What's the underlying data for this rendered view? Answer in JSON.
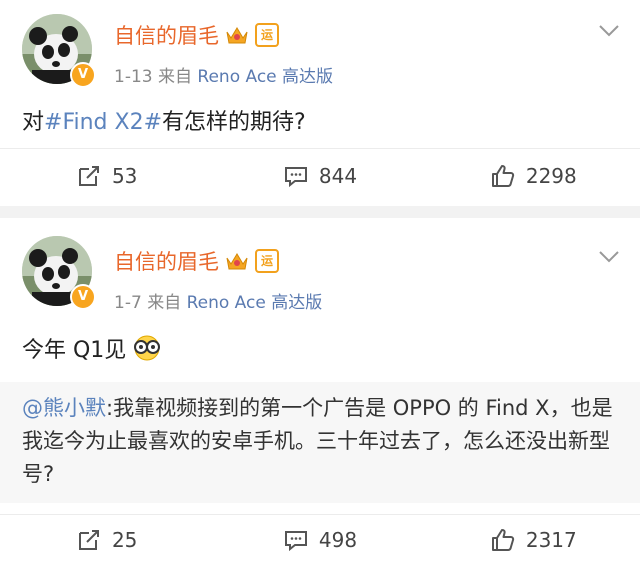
{
  "posts": [
    {
      "username": "自信的眉毛",
      "badge_text": "运",
      "date": "1-13",
      "source_prefix": "来自",
      "device": "Reno Ace 高达版",
      "content_prefix": "对",
      "hashtag": "#Find X2#",
      "content_suffix": "有怎样的期待?",
      "reposts": "53",
      "comments": "844",
      "likes": "2298"
    },
    {
      "username": "自信的眉毛",
      "badge_text": "运",
      "date": "1-7",
      "source_prefix": "来自",
      "device": "Reno Ace 高达版",
      "content": "今年 Q1见",
      "quote_mention": "@熊小默",
      "quote_text": ":我靠视频接到的第一个广告是 OPPO 的 Find X，也是我迄今为止最喜欢的安卓手机。三十年过去了，怎么还没出新型号?",
      "reposts": "25",
      "comments": "498",
      "likes": "2317"
    }
  ],
  "colors": {
    "username": "#e8672b",
    "link": "#5b83bd",
    "meta": "#888888",
    "verified": "#f8a51f"
  },
  "icons": [
    "panda-avatar",
    "verified-icon",
    "crown-icon",
    "chevron-down-icon",
    "repost-icon",
    "comment-icon",
    "like-icon",
    "glasses-emoji-icon"
  ]
}
